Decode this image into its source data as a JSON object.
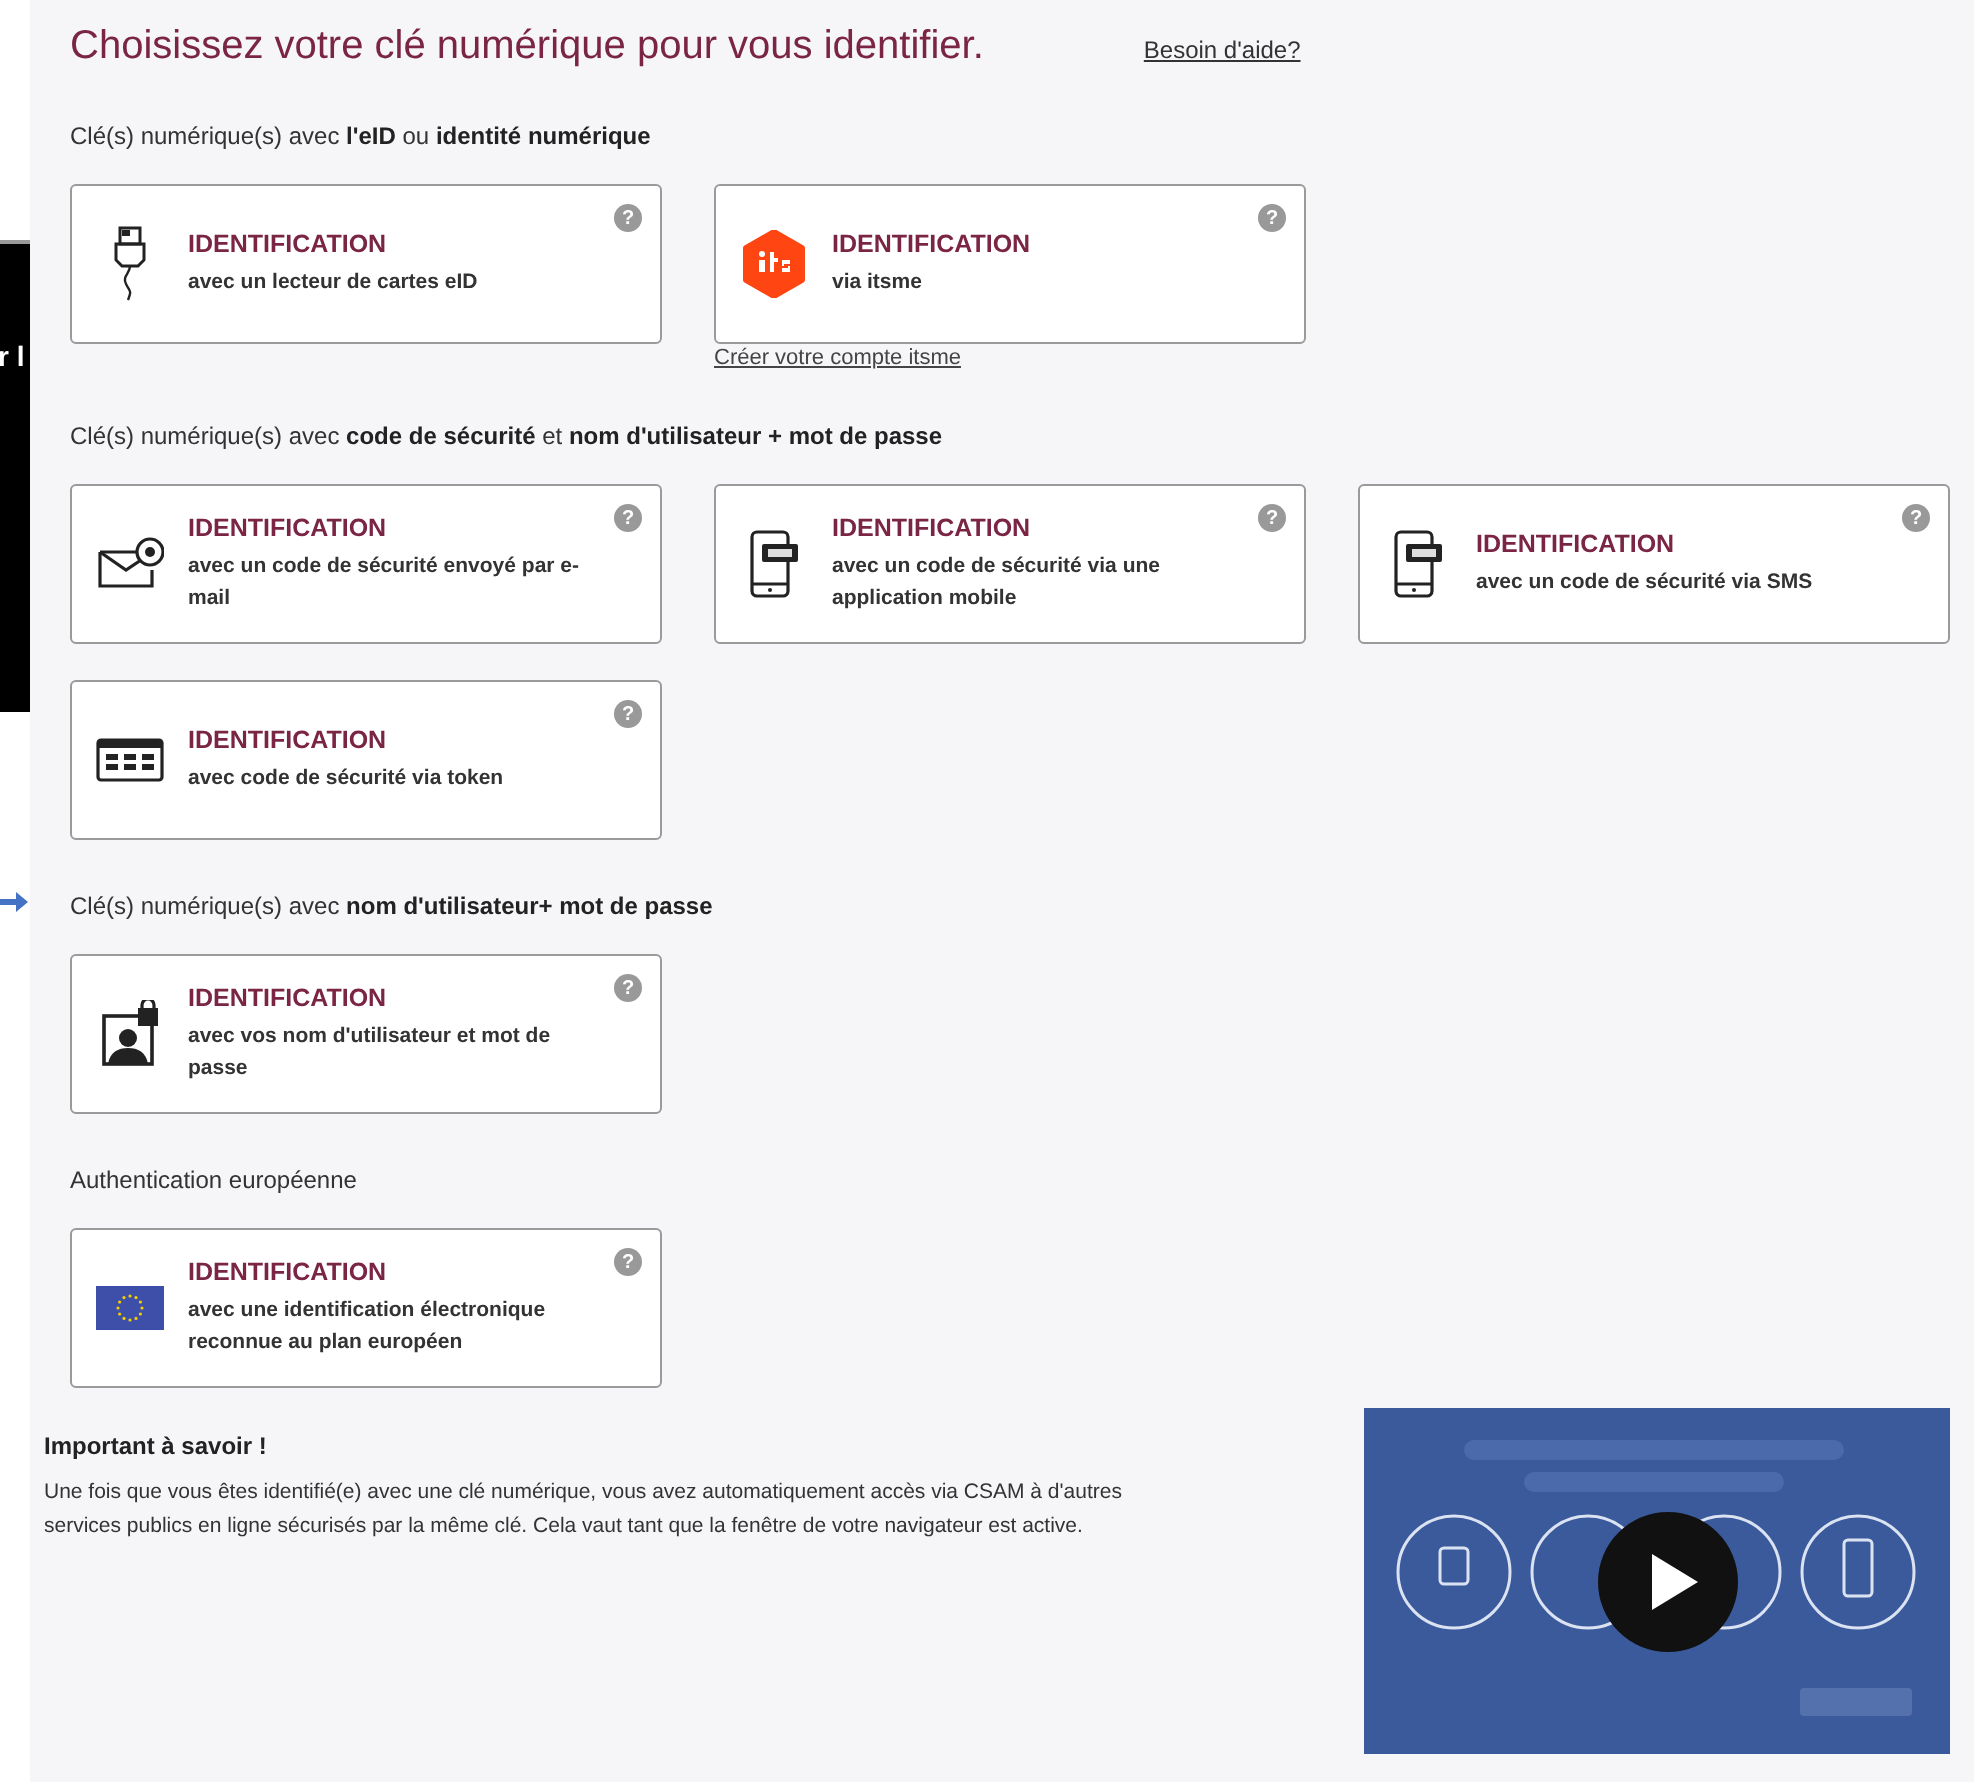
{
  "background_window": {
    "text": "r l"
  },
  "title": "Choisissez votre clé numérique pour vous identifier.",
  "help_link": "Besoin d'aide?",
  "sections": [
    {
      "heading": "Clé(s) numérique(s) avec **l'eID** ou **identité numérique**",
      "cards": [
        {
          "kind": "eid",
          "title": "IDENTIFICATION",
          "subtitle": "avec un lecteur de cartes eID",
          "help": "?"
        },
        {
          "kind": "itsme",
          "title": "IDENTIFICATION",
          "subtitle": "via itsme",
          "help": "?",
          "link": "Créer votre compte itsme"
        }
      ]
    },
    {
      "heading": "Clé(s) numérique(s) avec **code de sécurité** et **nom d'utilisateur + mot de passe**",
      "cards": [
        {
          "kind": "email",
          "title": "IDENTIFICATION",
          "subtitle": "avec un code de sécurité envoyé par e-mail",
          "help": "?"
        },
        {
          "kind": "app",
          "title": "IDENTIFICATION",
          "subtitle": "avec un code de sécurité via une application mobile",
          "help": "?"
        },
        {
          "kind": "sms",
          "title": "IDENTIFICATION",
          "subtitle": "avec un code de sécurité via SMS",
          "help": "?"
        },
        {
          "kind": "token",
          "title": "IDENTIFICATION",
          "subtitle": "avec code de sécurité via token",
          "help": "?"
        }
      ]
    },
    {
      "heading": "Clé(s) numérique(s) avec **nom d'utilisateur+ mot de passe**",
      "cards": [
        {
          "kind": "user",
          "title": "IDENTIFICATION",
          "subtitle": "avec vos nom d'utilisateur et mot de passe",
          "help": "?"
        }
      ]
    },
    {
      "heading": "Authentication européenne",
      "cards": [
        {
          "kind": "eu",
          "title": "IDENTIFICATION",
          "subtitle": "avec une identification électronique reconnue au plan européen",
          "help": "?"
        }
      ]
    }
  ],
  "info": {
    "title": "Important à savoir !",
    "text": "Une fois que vous êtes identifié(e) avec une clé numérique, vous avez automatiquement accès via CSAM à d'autres services publics en ligne sécurisés par la même clé. Cela vaut tant que la fenêtre de votre navigateur est active."
  }
}
